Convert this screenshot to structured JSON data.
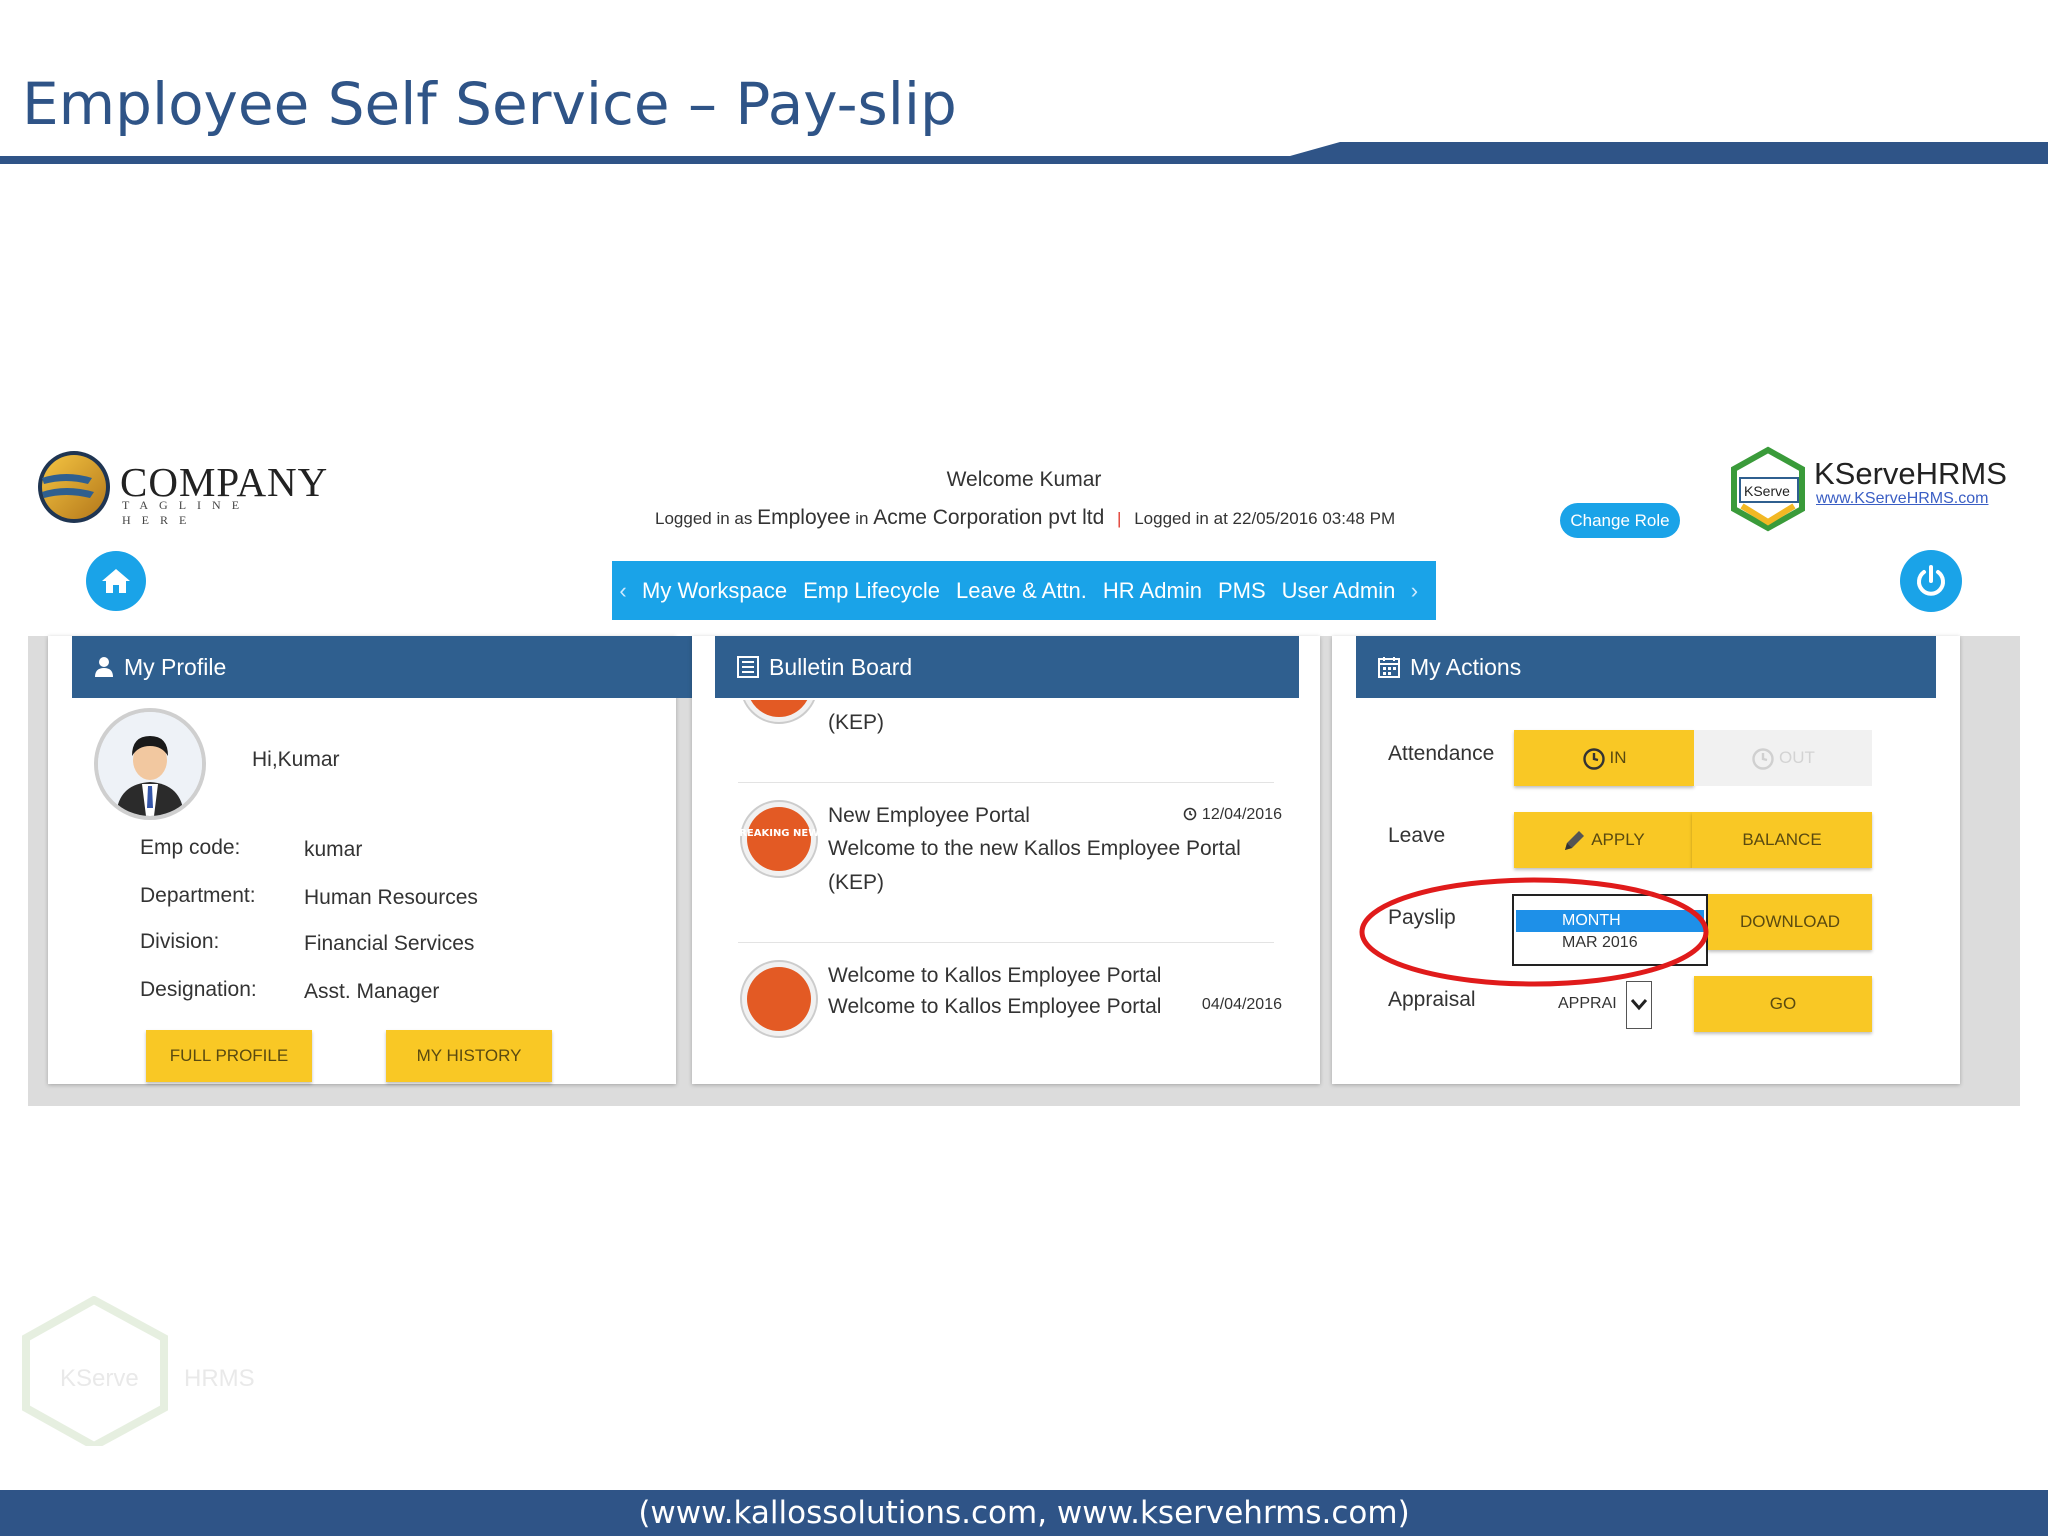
{
  "slide": {
    "title": "Employee Self Service – Pay-slip",
    "footer": "(www.kallossolutions.com, www.kservehrms.com)"
  },
  "header": {
    "company_logo": {
      "name": "COMPANY",
      "tagline": "TAGLINE HERE"
    },
    "welcome": "Welcome Kumar",
    "login": {
      "prefix": "Logged in as",
      "role": "Employee",
      "in_word": "in",
      "organization": "Acme Corporation pvt ltd",
      "logged_at_label": "Logged in at",
      "logged_at_value": "22/05/2016 03:48 PM"
    },
    "change_role_label": "Change Role",
    "kserve_logo": {
      "badge": "KServe",
      "name": "KServeHRMS",
      "url": "www.KServeHRMS.com"
    }
  },
  "nav": {
    "items": [
      "My Workspace",
      "Emp Lifecycle",
      "Leave & Attn.",
      "HR Admin",
      "PMS",
      "User Admin"
    ],
    "prev_glyph": "‹",
    "next_glyph": "›"
  },
  "icons": {
    "home": "home-icon",
    "power": "power-icon",
    "user": "user-icon",
    "list": "list-icon",
    "calendar": "calendar-icon",
    "clock": "clock-icon",
    "pencil": "pencil-icon"
  },
  "profile": {
    "header": "My Profile",
    "greeting": "Hi,Kumar",
    "fields": [
      {
        "label": "Emp code:",
        "value": "kumar"
      },
      {
        "label": "Department:",
        "value": "Human Resources"
      },
      {
        "label": "Division:",
        "value": "Financial Services"
      },
      {
        "label": "Designation:",
        "value": "Asst. Manager"
      }
    ],
    "full_profile_label": "FULL PROFILE",
    "history_label": "MY HISTORY"
  },
  "bulletin": {
    "header": "Bulletin Board",
    "badge_text": "BREAKING NEWS",
    "items": [
      {
        "title": "",
        "date": "",
        "body": "(KEP)"
      },
      {
        "title": "New Employee Portal",
        "date": "12/04/2016",
        "body": "Welcome to the new Kallos Employee Portal (KEP)"
      },
      {
        "title": "Welcome to Kallos Employee Portal",
        "date": "04/04/2016",
        "body": "Welcome to Kallos Employee Portal"
      }
    ]
  },
  "actions": {
    "header": "My Actions",
    "attendance": {
      "label": "Attendance",
      "in_label": "IN",
      "out_label": "OUT"
    },
    "leave": {
      "label": "Leave",
      "apply_label": "APPLY",
      "balance_label": "BALANCE"
    },
    "payslip": {
      "label": "Payslip",
      "options": [
        "MONTH",
        "MAR 2016"
      ],
      "selected": "MONTH",
      "download_label": "DOWNLOAD"
    },
    "appraisal": {
      "label": "Appraisal",
      "select_value": "APPRAI",
      "go_label": "GO"
    }
  },
  "colors": {
    "slide_blue": "#2f5487",
    "nav_blue": "#1aa3e8",
    "panel_header": "#2f5f8f",
    "button_yellow": "#f9c825",
    "highlight_red": "#e01b1b"
  },
  "watermark": {
    "text_left": "KServe",
    "text_right": "HRMS"
  }
}
